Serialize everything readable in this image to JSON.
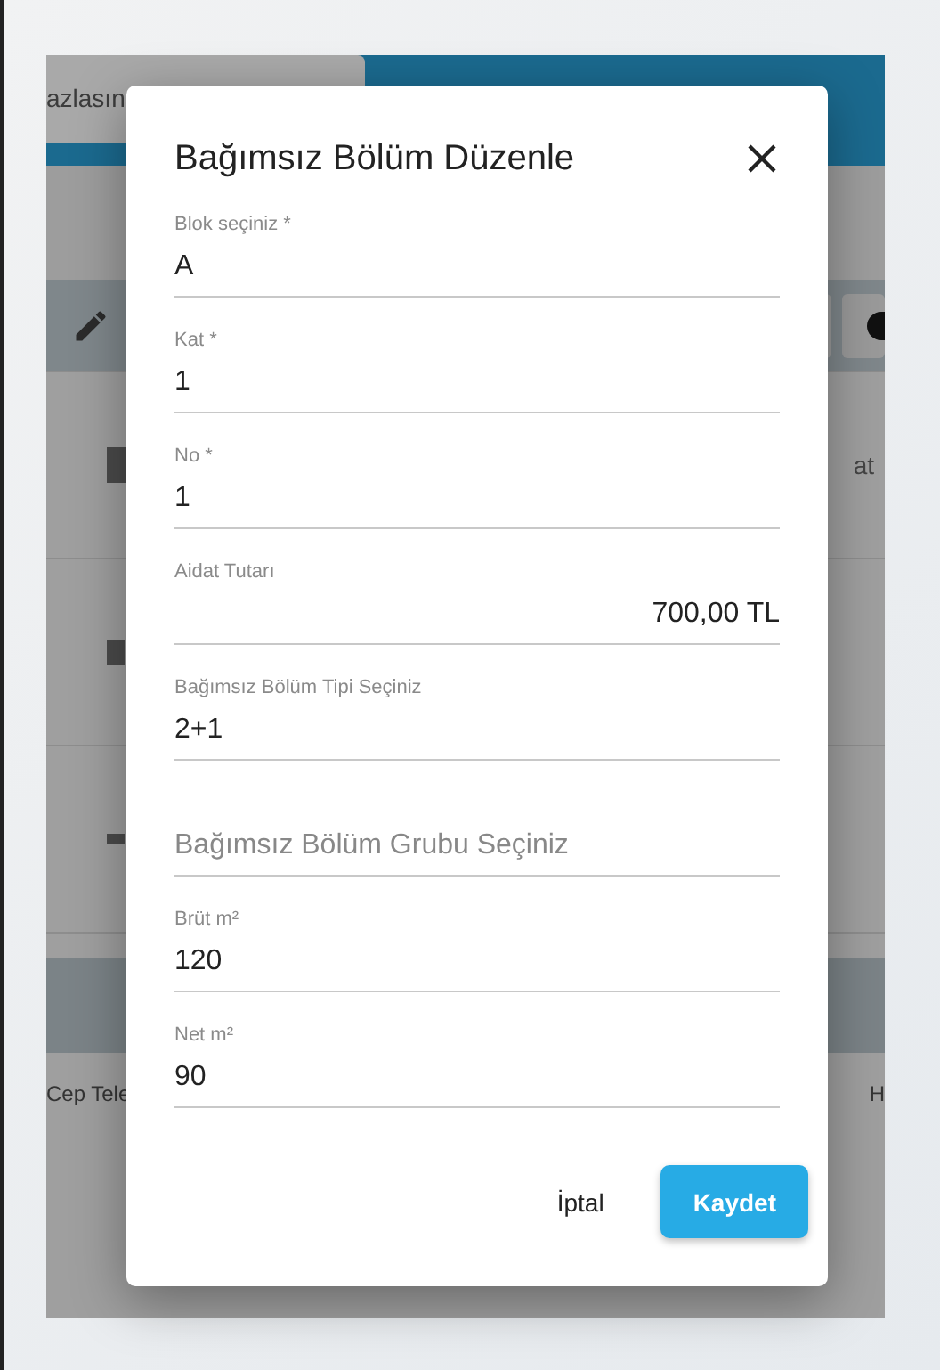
{
  "background": {
    "tab_label": "azlasın",
    "row_text": "at",
    "footer_texts": [
      "Cep Tele",
      "H"
    ]
  },
  "dialog": {
    "title": "Bağımsız Bölüm Düzenle",
    "fields": [
      {
        "kind": "text",
        "label": "Blok seçiniz *",
        "value": "A"
      },
      {
        "kind": "text",
        "label": "Kat *",
        "value": "1"
      },
      {
        "kind": "text",
        "label": "No *",
        "value": "1"
      },
      {
        "kind": "amount",
        "label": "Aidat Tutarı",
        "value": "700,00 TL"
      },
      {
        "kind": "text",
        "label": "Bağımsız Bölüm Tipi Seçiniz",
        "value": "2+1"
      },
      {
        "kind": "empty",
        "placeholder": "Bağımsız Bölüm Grubu Seçiniz"
      },
      {
        "kind": "text",
        "label": "Brüt m²",
        "value": "120"
      },
      {
        "kind": "text",
        "label": "Net m²",
        "value": "90"
      }
    ],
    "buttons": [
      {
        "kind": "text",
        "label": "İptal"
      },
      {
        "kind": "primary",
        "label": "Kaydet"
      }
    ]
  }
}
